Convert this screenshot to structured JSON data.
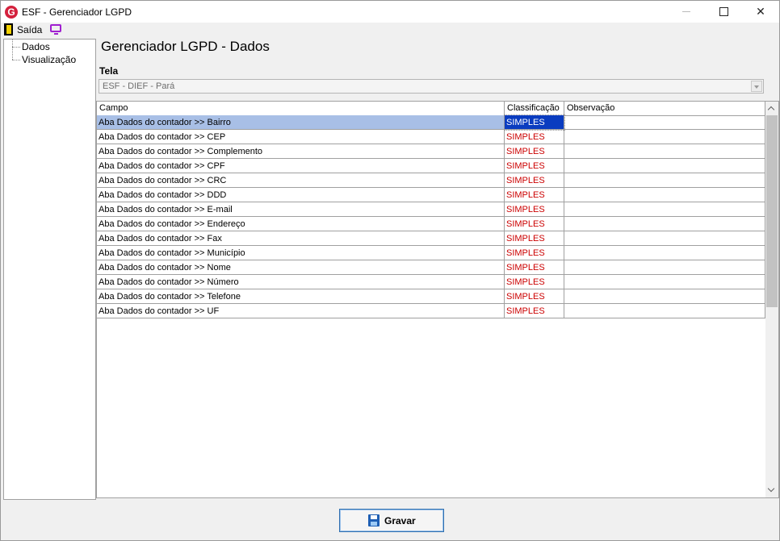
{
  "window": {
    "title": "ESF - Gerenciador LGPD",
    "logo_letter": "G",
    "minimize_glyph": "—",
    "maximize_glyph": "☐",
    "close_glyph": "✕"
  },
  "toolbar": {
    "exit_label": "Saída"
  },
  "tree": {
    "items": [
      {
        "label": "Dados"
      },
      {
        "label": "Visualização"
      }
    ]
  },
  "main": {
    "title": "Gerenciador LGPD - Dados",
    "tela_label": "Tela",
    "tela_value": "ESF - DIEF - Pará"
  },
  "grid": {
    "columns": [
      "Campo",
      "Classificação",
      "Observação"
    ],
    "rows": [
      {
        "campo": "Aba Dados do contador >> Bairro",
        "classificacao": "SIMPLES",
        "observacao": ""
      },
      {
        "campo": "Aba Dados do contador >> CEP",
        "classificacao": "SIMPLES",
        "observacao": ""
      },
      {
        "campo": "Aba Dados do contador >> Complemento",
        "classificacao": "SIMPLES",
        "observacao": ""
      },
      {
        "campo": "Aba Dados do contador >> CPF",
        "classificacao": "SIMPLES",
        "observacao": ""
      },
      {
        "campo": "Aba Dados do contador >> CRC",
        "classificacao": "SIMPLES",
        "observacao": ""
      },
      {
        "campo": "Aba Dados do contador >> DDD",
        "classificacao": "SIMPLES",
        "observacao": ""
      },
      {
        "campo": "Aba Dados do contador >> E-mail",
        "classificacao": "SIMPLES",
        "observacao": ""
      },
      {
        "campo": "Aba Dados do contador >> Endereço",
        "classificacao": "SIMPLES",
        "observacao": ""
      },
      {
        "campo": "Aba Dados do contador >> Fax",
        "classificacao": "SIMPLES",
        "observacao": ""
      },
      {
        "campo": "Aba Dados do contador >> Município",
        "classificacao": "SIMPLES",
        "observacao": ""
      },
      {
        "campo": "Aba Dados do contador >> Nome",
        "classificacao": "SIMPLES",
        "observacao": ""
      },
      {
        "campo": "Aba Dados do contador >> Número",
        "classificacao": "SIMPLES",
        "observacao": ""
      },
      {
        "campo": "Aba Dados do contador >> Telefone",
        "classificacao": "SIMPLES",
        "observacao": ""
      },
      {
        "campo": "Aba Dados do contador >> UF",
        "classificacao": "SIMPLES",
        "observacao": ""
      }
    ],
    "selected_row": 0
  },
  "footer": {
    "save_label": "Gravar"
  },
  "colors": {
    "accent": "#0a3cc0",
    "selection": "#a8bfe6",
    "classification_text": "#cc0000",
    "logo": "#d4213d"
  }
}
